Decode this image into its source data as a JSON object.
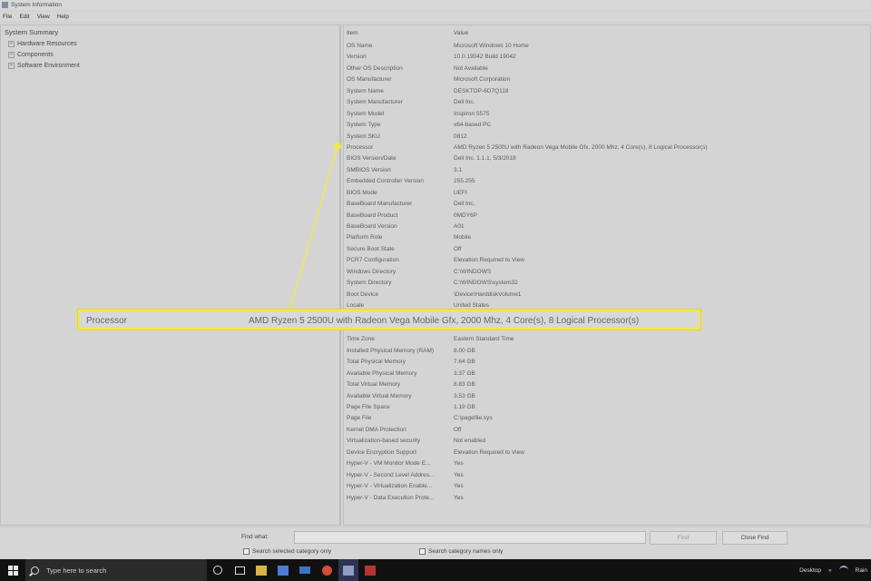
{
  "window": {
    "title": "System Information"
  },
  "menu": [
    "File",
    "Edit",
    "View",
    "Help"
  ],
  "tree": {
    "root": "System Summary",
    "children": [
      "Hardware Resources",
      "Components",
      "Software Environment"
    ]
  },
  "table": {
    "headers": {
      "item": "Item",
      "value": "Value"
    },
    "rows": [
      {
        "item": "OS Name",
        "value": "Microsoft Windows 10 Home"
      },
      {
        "item": "Version",
        "value": "10.0.19042 Build 19042"
      },
      {
        "item": "Other OS Description",
        "value": "Not Available"
      },
      {
        "item": "OS Manufacturer",
        "value": "Microsoft Corporation"
      },
      {
        "item": "System Name",
        "value": "DESKTOP-6D7Q118"
      },
      {
        "item": "System Manufacturer",
        "value": "Dell Inc."
      },
      {
        "item": "System Model",
        "value": "Inspiron 5575"
      },
      {
        "item": "System Type",
        "value": "x64-based PC"
      },
      {
        "item": "System SKU",
        "value": "0812"
      },
      {
        "item": "Processor",
        "value": "AMD Ryzen 5 2500U with Radeon Vega Mobile Gfx, 2000 Mhz, 4 Core(s), 8 Logical Processor(s)"
      },
      {
        "item": "BIOS Version/Date",
        "value": "Dell Inc. 1.1.1, 5/3/2018"
      },
      {
        "item": "SMBIOS Version",
        "value": "3.1"
      },
      {
        "item": "Embedded Controller Version",
        "value": "255.255"
      },
      {
        "item": "BIOS Mode",
        "value": "UEFI"
      },
      {
        "item": "BaseBoard Manufacturer",
        "value": "Dell Inc."
      },
      {
        "item": "BaseBoard Product",
        "value": "0MDY6P"
      },
      {
        "item": "BaseBoard Version",
        "value": "A01"
      },
      {
        "item": "Platform Role",
        "value": "Mobile"
      },
      {
        "item": "Secure Boot State",
        "value": "Off"
      },
      {
        "item": "PCR7 Configuration",
        "value": "Elevation Required to View"
      },
      {
        "item": "Windows Directory",
        "value": "C:\\WINDOWS"
      },
      {
        "item": "System Directory",
        "value": "C:\\WINDOWS\\system32"
      },
      {
        "item": "Boot Device",
        "value": "\\Device\\HarddiskVolume1"
      },
      {
        "item": "Locale",
        "value": "United States"
      },
      {
        "item": "",
        "value": ""
      },
      {
        "item": "",
        "value": ""
      },
      {
        "item": "Time Zone",
        "value": "Eastern Standard Time"
      },
      {
        "item": "Installed Physical Memory (RAM)",
        "value": "8.00 GB"
      },
      {
        "item": "Total Physical Memory",
        "value": "7.64 GB"
      },
      {
        "item": "Available Physical Memory",
        "value": "3.37 GB"
      },
      {
        "item": "Total Virtual Memory",
        "value": "8.83 GB"
      },
      {
        "item": "Available Virtual Memory",
        "value": "3.53 GB"
      },
      {
        "item": "Page File Space",
        "value": "1.19 GB"
      },
      {
        "item": "Page File",
        "value": "C:\\pagefile.sys"
      },
      {
        "item": "Kernel DMA Protection",
        "value": "Off"
      },
      {
        "item": "Virtualization-based security",
        "value": "Not enabled"
      },
      {
        "item": "Device Encryption Support",
        "value": "Elevation Required to View"
      },
      {
        "item": "Hyper-V - VM Monitor Mode E...",
        "value": "Yes"
      },
      {
        "item": "Hyper-V - Second Level Addres...",
        "value": "Yes"
      },
      {
        "item": "Hyper-V - Virtualization Enable...",
        "value": "Yes"
      },
      {
        "item": "Hyper-V - Data Execution Prote...",
        "value": "Yes"
      }
    ]
  },
  "callout": {
    "item": "Processor",
    "value": "AMD Ryzen 5 2500U with Radeon Vega Mobile Gfx, 2000 Mhz, 4 Core(s), 8 Logical Processor(s)",
    "color": "#f2e64a"
  },
  "find": {
    "label": "Find what:",
    "value": "",
    "find_button": "Find",
    "close_button": "Close Find",
    "option_selected": "Search selected category only",
    "option_names": "Search category names only"
  },
  "taskbar": {
    "search_placeholder": "Type here to search",
    "apps": [
      "task-view",
      "file-explorer",
      "store",
      "mail",
      "chrome",
      "system-information",
      "app-red"
    ],
    "desktop_label": "Desktop",
    "user": "Rain"
  }
}
